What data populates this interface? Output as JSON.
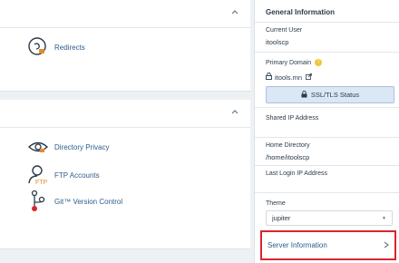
{
  "panels": {
    "top": {
      "items": [
        {
          "label": "Redirects",
          "icon": "redirects-icon"
        }
      ]
    },
    "second": {
      "items": [
        {
          "label": "Directory Privacy",
          "icon": "eye-icon"
        },
        {
          "label": "FTP Accounts",
          "icon": "ftp-user-icon"
        },
        {
          "label": "Git™ Version Control",
          "icon": "git-icon"
        }
      ]
    }
  },
  "sidebar": {
    "title": "General Information",
    "current_user_label": "Current User",
    "current_user": "itoolscp",
    "primary_domain_label": "Primary Domain",
    "primary_domain": "itools.mn",
    "ssl_button": "SSL/TLS Status",
    "shared_ip_label": "Shared IP Address",
    "home_directory_label": "Home Directory",
    "home_directory": "/home/itoolscp",
    "last_login_label": "Last Login IP Address",
    "theme_label": "Theme",
    "theme_value": "jupiter",
    "server_info": "Server Information"
  },
  "colors": {
    "accent": "#2c5d8a",
    "highlight": "#d9262b",
    "warning": "#e7a21d",
    "orange": "#e58b2e"
  }
}
